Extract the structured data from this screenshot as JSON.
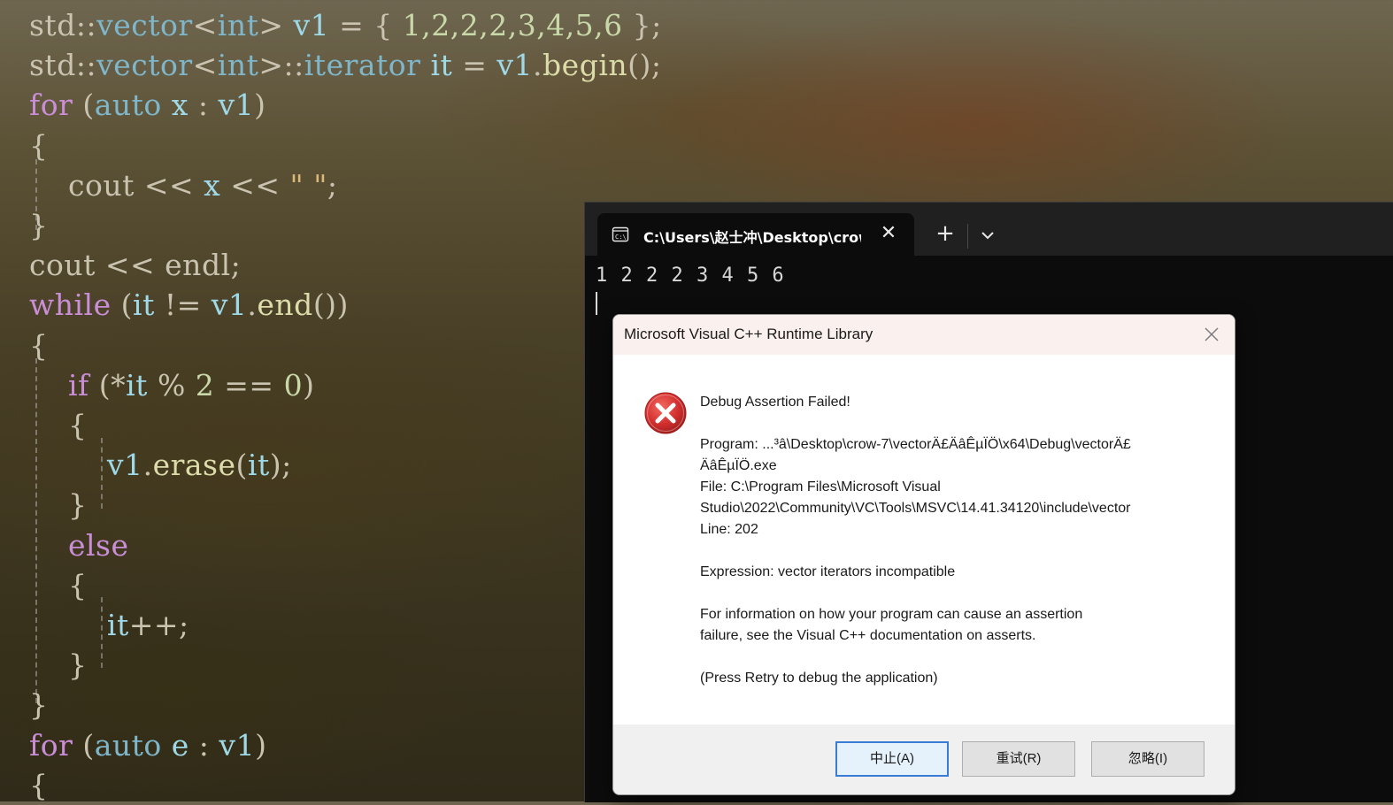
{
  "editor": {
    "lines": [
      [
        [
          "std::",
          "plain"
        ],
        [
          "vector",
          "type"
        ],
        [
          "<",
          "plain"
        ],
        [
          "int",
          "type"
        ],
        [
          "> ",
          "plain"
        ],
        [
          "v1",
          "var"
        ],
        [
          " = { ",
          "plain"
        ],
        [
          "1,2,2,2,3,4,5,6",
          "num"
        ],
        [
          " };",
          "plain"
        ]
      ],
      [
        [
          "std::",
          "plain"
        ],
        [
          "vector",
          "type"
        ],
        [
          "<",
          "plain"
        ],
        [
          "int",
          "type"
        ],
        [
          ">::",
          "plain"
        ],
        [
          "iterator ",
          "type"
        ],
        [
          "it",
          "var"
        ],
        [
          " = ",
          "plain"
        ],
        [
          "v1",
          "var"
        ],
        [
          ".",
          "plain"
        ],
        [
          "begin",
          "fn"
        ],
        [
          "();",
          "plain"
        ]
      ],
      [
        [
          "for",
          "kw"
        ],
        [
          " (",
          "plain"
        ],
        [
          "auto ",
          "type"
        ],
        [
          "x",
          "var"
        ],
        [
          " : ",
          "plain"
        ],
        [
          "v1",
          "var"
        ],
        [
          ")",
          "plain"
        ]
      ],
      [
        [
          "{",
          "plain"
        ]
      ],
      [
        [
          "    ",
          "plain"
        ],
        [
          "cout",
          "plain"
        ],
        [
          " << ",
          "plain"
        ],
        [
          "x",
          "var"
        ],
        [
          " << ",
          "plain"
        ],
        [
          "\" \"",
          "str"
        ],
        [
          ";",
          "plain"
        ]
      ],
      [
        [
          "}",
          "plain"
        ]
      ],
      [
        [
          "cout",
          "plain"
        ],
        [
          " << ",
          "plain"
        ],
        [
          "endl",
          "plain"
        ],
        [
          ";",
          "plain"
        ]
      ],
      [
        [
          "while",
          "kw"
        ],
        [
          " (",
          "plain"
        ],
        [
          "it",
          "var"
        ],
        [
          " != ",
          "plain"
        ],
        [
          "v1",
          "var"
        ],
        [
          ".",
          "plain"
        ],
        [
          "end",
          "fn"
        ],
        [
          "())",
          "plain"
        ]
      ],
      [
        [
          "{",
          "plain"
        ]
      ],
      [
        [
          "    ",
          "plain"
        ],
        [
          "if",
          "kw"
        ],
        [
          " (*",
          "plain"
        ],
        [
          "it",
          "var"
        ],
        [
          " % ",
          "plain"
        ],
        [
          "2",
          "num"
        ],
        [
          " == ",
          "plain"
        ],
        [
          "0",
          "num"
        ],
        [
          ")",
          "plain"
        ]
      ],
      [
        [
          "    {",
          "plain"
        ]
      ],
      [
        [
          "        ",
          "plain"
        ],
        [
          "v1",
          "var"
        ],
        [
          ".",
          "plain"
        ],
        [
          "erase",
          "fn"
        ],
        [
          "(",
          "plain"
        ],
        [
          "it",
          "var"
        ],
        [
          ");",
          "plain"
        ]
      ],
      [
        [
          "    }",
          "plain"
        ]
      ],
      [
        [
          "    ",
          "plain"
        ],
        [
          "else",
          "kw"
        ]
      ],
      [
        [
          "    {",
          "plain"
        ]
      ],
      [
        [
          "        ",
          "plain"
        ],
        [
          "it",
          "var"
        ],
        [
          "++;",
          "plain"
        ]
      ],
      [
        [
          "    }",
          "plain"
        ]
      ],
      [
        [
          "}",
          "plain"
        ]
      ],
      [
        [
          "for",
          "kw"
        ],
        [
          " (",
          "plain"
        ],
        [
          "auto ",
          "type"
        ],
        [
          "e",
          "var"
        ],
        [
          " : ",
          "plain"
        ],
        [
          "v1",
          "var"
        ],
        [
          ")",
          "plain"
        ]
      ],
      [
        [
          "{",
          "plain"
        ]
      ]
    ]
  },
  "terminal": {
    "tab_title": "C:\\Users\\赵士冲\\Desktop\\crow",
    "close_glyph": "✕",
    "new_tab_glyph": "+",
    "output": "1 2 2 2 3 4 5 6",
    "icon": "terminal-icon"
  },
  "dialog": {
    "title": "Microsoft Visual C++ Runtime Library",
    "icon": "error-icon",
    "heading": "Debug Assertion Failed!",
    "program_line1": "Program: ...³â\\Desktop\\crow-7\\vectorÄ£ÄâÊµÏÖ\\x64\\Debug\\vectorÄ£",
    "program_line2": "ÄâÊµÏÖ.exe",
    "file_line1": "File: C:\\Program Files\\Microsoft Visual",
    "file_line2": "Studio\\2022\\Community\\VC\\Tools\\MSVC\\14.41.34120\\include\\vector",
    "line_info": "Line: 202",
    "expression": "Expression: vector iterators incompatible",
    "info_line1": "For information on how your program can cause an assertion",
    "info_line2": "failure, see the Visual C++ documentation on asserts.",
    "retry_hint": "(Press Retry to debug the application)",
    "buttons": {
      "abort": "中止(A)",
      "retry": "重试(R)",
      "ignore": "忽略(I)"
    }
  },
  "colors": {
    "terminal_bg": "#0c0c0c",
    "tabbar_bg": "#202020",
    "dialog_title_bg": "#faf0ee",
    "error_red": "#d32f2f"
  }
}
